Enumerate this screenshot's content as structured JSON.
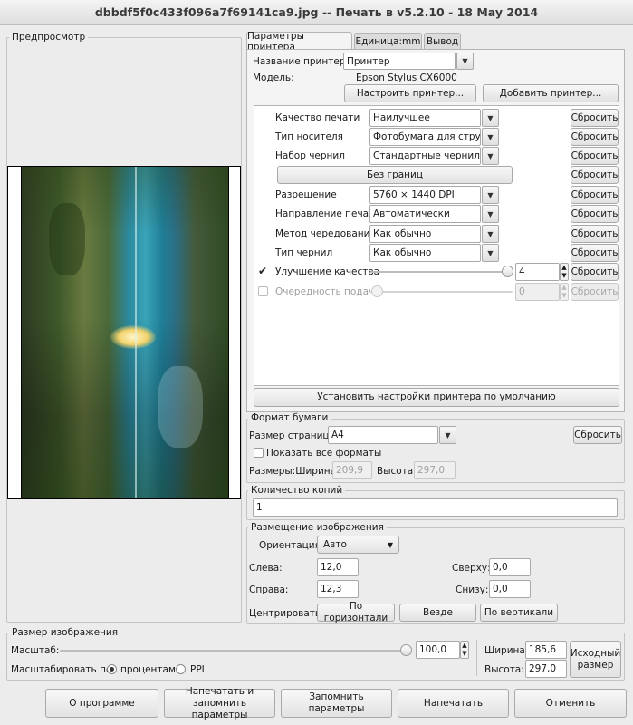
{
  "window": {
    "title": "dbbdf5f0c433f096a7f69141ca9.jpg -- Печать в v5.2.10 - 18 May 2014"
  },
  "preview": {
    "legend": "Предпросмотр"
  },
  "tabs": [
    {
      "label": "Параметры принтера"
    },
    {
      "label": "Единица:mm"
    },
    {
      "label": "Вывод"
    }
  ],
  "printer": {
    "name_label": "Название принтера:",
    "name_value": "Принтер",
    "model_label": "Модель:",
    "model_value": "Epson Stylus CX6000",
    "configure_button": "Настроить принтер...",
    "add_button": "Добавить принтер...",
    "settings": [
      {
        "label": "Качество печати",
        "value": "Наилучшее"
      },
      {
        "label": "Тип носителя",
        "value": "Фотобумага для струйн"
      },
      {
        "label": "Набор чернил",
        "value": "Стандартные чернила E"
      }
    ],
    "borderless_button": "Без границ",
    "settings2": [
      {
        "label": "Разрешение",
        "value": "5760 × 1440 DPI"
      },
      {
        "label": "Направление печати",
        "value": "Автоматически"
      },
      {
        "label": "Метод чередования",
        "value": "Как обычно"
      },
      {
        "label": "Тип чернил",
        "value": "Как обычно"
      }
    ],
    "reset_label": "Сбросить",
    "quality_enh": {
      "label": "Улучшение качества",
      "value": "4",
      "checked": true,
      "level": 1.0
    },
    "feed_order": {
      "label": "Очередность подачи",
      "value": "0",
      "checked": false,
      "level": 0.0
    },
    "defaults_button": "Установить настройки принтера по умолчанию"
  },
  "paper": {
    "legend": "Формат бумаги",
    "size_label": "Размер страницы",
    "size_value": "A4",
    "reset_button": "Сбросить",
    "show_all_label": "Показать все форматы",
    "dims_label": "Размеры:",
    "width_label": "Ширина:",
    "width_value": "209,9",
    "height_label": "Высота:",
    "height_value": "297,0"
  },
  "copies": {
    "legend": "Количество копий",
    "value": "1"
  },
  "placement": {
    "legend": "Размещение изображения",
    "orientation_label": "Ориентация:",
    "orientation_value": "Авто",
    "left_label": "Слева:",
    "left_value": "12,0",
    "top_label": "Сверху:",
    "top_value": "0,0",
    "right_label": "Справа:",
    "right_value": "12,3",
    "bottom_label": "Снизу:",
    "bottom_value": "0,0",
    "center_label": "Центрировать:",
    "center_h": "По горизонтали",
    "center_both": "Везде",
    "center_v": "По вертикали"
  },
  "image_size": {
    "legend": "Размер изображения",
    "scale_label": "Масштаб:",
    "scale_value": "100,0",
    "scale_level": 1.0,
    "scale_by_label": "Масштабировать по:",
    "radio_percent": "процентам",
    "radio_ppi": "PPI",
    "width_label": "Ширина:",
    "width_value": "185,6",
    "height_label": "Высота:",
    "height_value": "297,0",
    "original_button_l1": "Исходный",
    "original_button_l2": "размер"
  },
  "bottom": {
    "about": "О программе",
    "print_save_l1": "Напечатать и",
    "print_save_l2": "запомнить параметры",
    "save_l1": "Запомнить",
    "save_l2": "параметры",
    "print": "Напечатать",
    "cancel": "Отменить"
  }
}
